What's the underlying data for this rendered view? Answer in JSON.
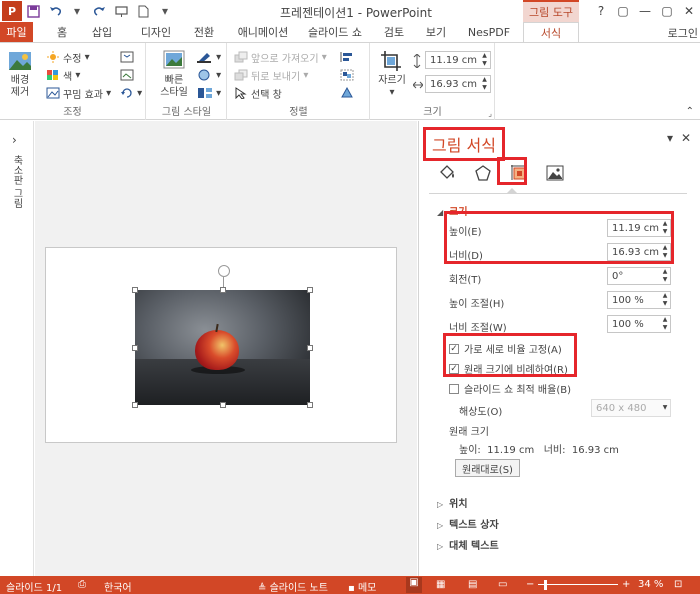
{
  "app": {
    "title": "프레젠테이션1 - PowerPoint",
    "logo_text": "P",
    "contextual_tab_label": "그림 도구"
  },
  "tabs": [
    "파일",
    "홈",
    "삽입",
    "디자인",
    "전환",
    "애니메이션",
    "슬라이드 쇼",
    "검토",
    "보기",
    "NesPDF",
    "서식"
  ],
  "active_tab": "서식",
  "login": "로그인",
  "window_buttons": [
    "?",
    "▢",
    "—",
    "▢",
    "✕"
  ],
  "ribbon": {
    "adjust": {
      "remove_bg_line1": "배경",
      "remove_bg_line2": "제거",
      "corrections": "수정",
      "color": "색",
      "artistic": "꾸밈 효과",
      "label": "조정"
    },
    "picture_styles": {
      "quick_styles_line1": "빠른",
      "quick_styles_line2": "스타일",
      "label": "그림 스타일"
    },
    "arrange": {
      "bring_forward": "앞으로 가져오기",
      "send_backward": "뒤로 보내기",
      "selection_pane": "선택 창",
      "label": "정렬"
    },
    "size": {
      "crop": "자르기",
      "height": "11.19 cm",
      "width": "16.93 cm",
      "label": "크기"
    }
  },
  "left_pane": {
    "label": "축소판 그림"
  },
  "format_pane": {
    "title": "그림 서식",
    "size_section": "크기",
    "height_label": "높이(E)",
    "height_value": "11.19 cm",
    "width_label": "너비(D)",
    "width_value": "16.93 cm",
    "rotation_label": "회전(T)",
    "rotation_value": "0°",
    "scale_h_label": "높이 조절(H)",
    "scale_h_value": "100 %",
    "scale_w_label": "너비 조절(W)",
    "scale_w_value": "100 %",
    "lock_aspect": "가로 세로 비율 고정(A)",
    "lock_aspect_checked": true,
    "relative_original": "원래 크기에 비례하여(R)",
    "relative_original_checked": true,
    "best_scale": "슬라이드 쇼 최적 배율(B)",
    "best_scale_checked": false,
    "resolution_label": "해상도(O)",
    "resolution_value": "640 x 480",
    "original_size_label": "원래 크기",
    "orig_height_label": "높이:",
    "orig_height": "11.19 cm",
    "orig_width_label": "너비:",
    "orig_width": "16.93 cm",
    "reset_button": "원래대로(S)",
    "position_section": "위치",
    "textbox_section": "텍스트 상자",
    "alt_text_section": "대체 텍스트"
  },
  "status": {
    "slide_info": "슬라이드 1/1",
    "language": "한국어",
    "notes": "슬라이드 노트",
    "comments": "메모",
    "zoom": "34 %"
  },
  "colors": {
    "accent": "#d24726",
    "highlight_red": "#e5262b"
  }
}
